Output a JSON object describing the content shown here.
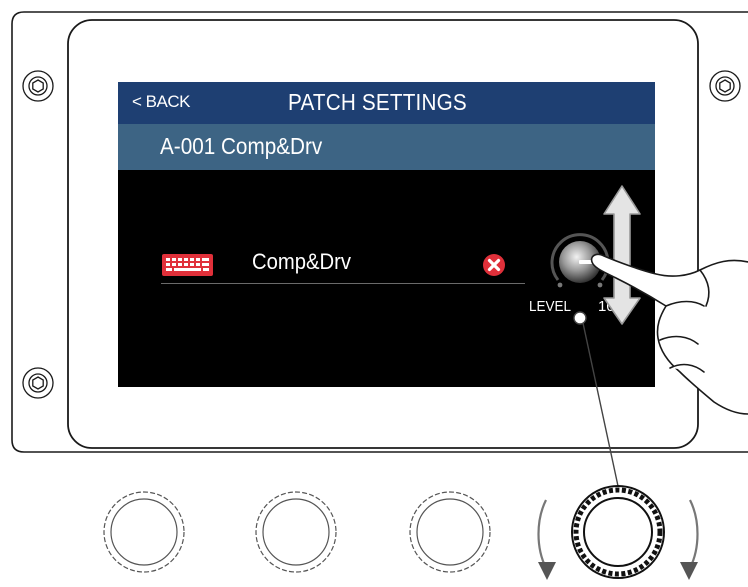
{
  "titlebar": {
    "back_label": "< BACK",
    "title": "PATCH SETTINGS"
  },
  "patch": {
    "id_and_name": "A-001 Comp&Drv"
  },
  "name_editor": {
    "name_value": "Comp&Drv",
    "keyboard_icon": "keyboard-icon",
    "clear_icon": "clear-x-icon"
  },
  "level": {
    "label": "LEVEL",
    "value": "100"
  },
  "colors": {
    "titlebar": "#1e3f72",
    "subbar": "#3d6484",
    "screen": "#000000",
    "accent_red": "#e0303a"
  }
}
